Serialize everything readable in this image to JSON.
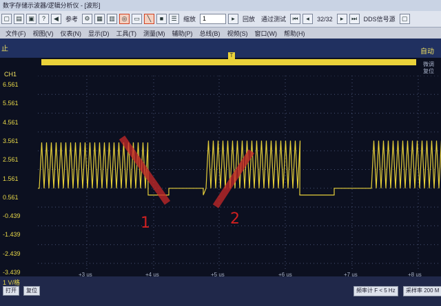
{
  "window": {
    "title": "数字存储示波器/逻辑分析仪 - [波形]"
  },
  "toolbar": {
    "ref_label": "参考",
    "zoom_label": "缩放",
    "zoom_value": "1",
    "playback_label": "回放",
    "pass_test_label": "通过测试",
    "page_label": "32/32",
    "dds_label": "DDS信号源"
  },
  "menu": [
    "文件(F)",
    "视图(V)",
    "仪表(N)",
    "显示(D)",
    "工具(T)",
    "测量(M)",
    "辅助(P)",
    "总线(B)",
    "视频(S)",
    "窗口(W)",
    "帮助(H)"
  ],
  "status": {
    "run_state": "止",
    "trigger_mode": "自动"
  },
  "side_buttons": {
    "fine": "微调",
    "reset": "复位"
  },
  "channel": {
    "name": "CH1"
  },
  "y_ticks": [
    "6.561",
    "5.561",
    "4.561",
    "3.561",
    "2.561",
    "1.561",
    "0.561",
    "-0.439",
    "-1.439",
    "-2.439",
    "-3.439"
  ],
  "x_ticks": [
    "+3 us",
    "+4 us",
    "+5 us",
    "+6 us",
    "+7 us",
    "+8 us"
  ],
  "bottom": {
    "vdiv": "1 V/格",
    "buttons": [
      "打开",
      "复位"
    ],
    "freq_counter": "频率计 F < 5 Hz",
    "sample_rate": "采样率 200 M"
  },
  "annotations": [
    "1",
    "2"
  ],
  "colors": {
    "trace": "#e6cf3a",
    "background": "#0c1020",
    "grid": "#4a5578",
    "annotation": "#d02020"
  }
}
